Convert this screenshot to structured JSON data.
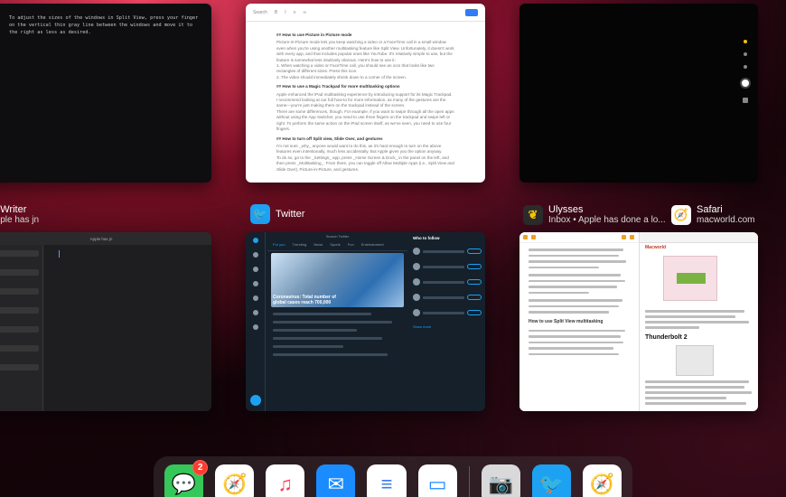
{
  "terminal_card": {
    "text": "To adjust the sizes of the windows in Split View, press your finger on the vertical thin gray line between the windows and move it to the right as less as desired."
  },
  "document_card": {
    "search_placeholder": "Search",
    "headings": [
      "## How to use Picture in Picture mode",
      "## How to use a Magic Trackpad for more multitasking options",
      "## How to turn off Split view, Slide Over, and gestures"
    ],
    "paragraphs": [
      "Picture-in-Picture mode lets you keep watching a video or a FaceTime call in a small window even when you're using another multitasking feature like Split View. Unfortunately, it doesn't work with every app, and that includes popular ones like YouTube. It's relatively simple to use, but the feature is somewhat less intuitively obvious. Here's how to use it:",
      "1. When watching a video or FaceTime call, you should see an icon that looks like two rectangles of different sizes. Press this icon.",
      "2. The video should immediately shrink down to a corner of the screen.",
      "Apple enhanced the iPad multitasking experience by introducing support for its Magic Trackpad. I recommend looking at our full how-to for more information, as many of the gestures are the same—you're just making them on the trackpad instead of the screen.",
      "There are some differences, though. For example, if you want to swipe through all the open apps without using the App Switcher, you need to use three fingers on the trackpad and swipe left or right. To perform the same action on the iPad screen itself, as we've seen, you need to use four fingers.",
      "I'm not sure _why_ anyone would want to do this, as it's hard enough to turn on the above features even intentionally, much less accidentally. But Apple gives you the option anyway.",
      "To do so, go to the _Settings_ app, press _Home Screen & Dock_ in the panel on the left, and then press _Multitasking_. From there, you can toggle off Allow Multiple Apps (i.e., Split View and Slide Over), Picture-in-Picture, and gestures."
    ]
  },
  "app_labels": {
    "iawriter": {
      "name": "iA Writer",
      "subtitle": "Apple has jn"
    },
    "twitter": {
      "name": "Twitter"
    },
    "ulysses": {
      "name": "Ulysses",
      "subtitle": "Inbox • Apple has done a lo..."
    },
    "safari": {
      "name": "Safari",
      "subtitle": "macworld.com"
    }
  },
  "iawriter_card": {
    "title": "Apple has jn"
  },
  "twitter_card": {
    "search_placeholder": "Search Twitter",
    "tabs": [
      "For you",
      "Trending",
      "News",
      "Sports",
      "Fun",
      "Entertainment"
    ],
    "hero_caption": "Coronavirus: Total number of global cases reach 700,000",
    "who_to_follow": "Who to follow",
    "follow_label": "Follow",
    "show_more": "Show more"
  },
  "ulysses_card": {
    "heading": "How to use Split View multitasking"
  },
  "safari_card": {
    "site": "Macworld",
    "section_heading": "Thunderbolt 2"
  },
  "dock": {
    "apps": [
      {
        "name": "Messages",
        "glyph": "💬",
        "badge": "2",
        "bg": "#35c759"
      },
      {
        "name": "Safari",
        "glyph": "🧭",
        "bg": "#ffffff"
      },
      {
        "name": "Music",
        "glyph": "♫",
        "bg": "#ffffff"
      },
      {
        "name": "Mail",
        "glyph": "✉",
        "bg": "#1a8cff"
      },
      {
        "name": "Docs",
        "glyph": "≡",
        "bg": "#ffffff"
      },
      {
        "name": "Files",
        "glyph": "▭",
        "bg": "#ffffff"
      },
      {
        "name": "Camera",
        "glyph": "📷",
        "bg": "#d9d9d9"
      },
      {
        "name": "Twitter",
        "glyph": "🐦",
        "bg": "#1da1f2"
      },
      {
        "name": "Safari",
        "glyph": "🧭",
        "bg": "#ffffff"
      }
    ]
  },
  "colors": {
    "accent_blue": "#1da1f2",
    "badge_red": "#ff3b30"
  }
}
